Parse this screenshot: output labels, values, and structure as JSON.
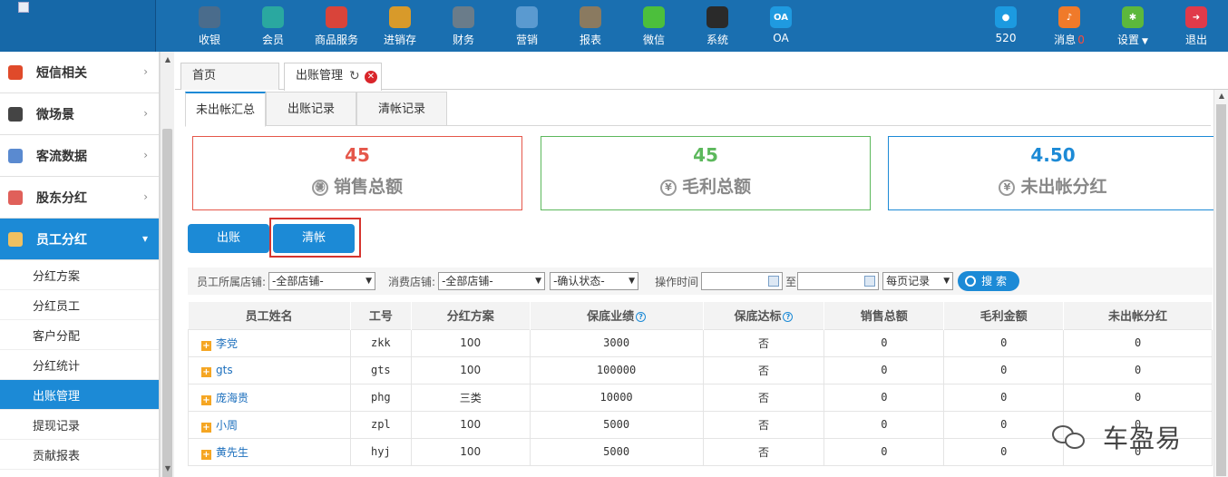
{
  "topnav": {
    "items": [
      {
        "label": "收银",
        "icon": "cash-register-icon",
        "color": "#4a6c8c"
      },
      {
        "label": "会员",
        "icon": "member-icon",
        "color": "#2aa8a0"
      },
      {
        "label": "商品服务",
        "icon": "product-service-icon",
        "color": "#d9443a"
      },
      {
        "label": "进销存",
        "icon": "inventory-icon",
        "color": "#d89a2a"
      },
      {
        "label": "财务",
        "icon": "finance-icon",
        "color": "#6a7c8a"
      },
      {
        "label": "营销",
        "icon": "marketing-icon",
        "color": "#5a9ad0"
      },
      {
        "label": "报表",
        "icon": "report-icon",
        "color": "#8a7a60"
      },
      {
        "label": "微信",
        "icon": "wechat-icon",
        "color": "#4cbf3c"
      },
      {
        "label": "系统",
        "icon": "system-icon",
        "color": "#2a2a2a"
      },
      {
        "label": "OA",
        "icon": "oa-icon",
        "color": "#1f9ae0",
        "text": "OA"
      }
    ],
    "right": {
      "user_label": "520",
      "message_label": "消息",
      "message_count": "0",
      "settings_label": "设置",
      "logout_label": "退出"
    }
  },
  "sidebar": {
    "groups": [
      {
        "label": "短信相关",
        "icon": "phone-icon",
        "color": "#e04a2a"
      },
      {
        "label": "微场景",
        "icon": "mobile-icon",
        "color": "#444"
      },
      {
        "label": "客流数据",
        "icon": "traffic-icon",
        "color": "#5a8ad0"
      },
      {
        "label": "股东分红",
        "icon": "shareholder-icon",
        "color": "#e0605a"
      }
    ],
    "active_group": {
      "label": "员工分红",
      "icon": "staff-icon",
      "color": "#f0c060"
    },
    "subitems": [
      "分红方案",
      "分红员工",
      "客户分配",
      "分红统计",
      "出账管理",
      "提现记录",
      "贡献报表"
    ],
    "active_subitem_index": 4
  },
  "tabs": {
    "home": "首页",
    "active": "出账管理"
  },
  "subtabs": [
    "未出帐汇总",
    "出账记录",
    "清帐记录"
  ],
  "cards": [
    {
      "value": "45",
      "caption": "销售总额",
      "symbol": "㊝"
    },
    {
      "value": "45",
      "caption": "毛利总额",
      "symbol": "¥"
    },
    {
      "value": "4.50",
      "caption": "未出帐分红",
      "symbol": "¥"
    }
  ],
  "buttons": {
    "checkout": "出账",
    "clear": "清帐"
  },
  "filters": {
    "store_label": "员工所属店铺:",
    "store_value": "-全部店铺-",
    "consume_label": "消费店铺:",
    "consume_value": "-全部店铺-",
    "status_value": "-确认状态-",
    "time_label": "操作时间",
    "to_label": "至",
    "per_page_value": "每页记录",
    "search_label": "搜 索"
  },
  "table": {
    "headers": [
      "员工姓名",
      "工号",
      "分红方案",
      "保底业绩",
      "保底达标",
      "销售总额",
      "毛利金额",
      "未出帐分红"
    ],
    "rows": [
      [
        "李党",
        "zkk",
        "100",
        "3000",
        "否",
        "0",
        "0",
        "0"
      ],
      [
        "gts",
        "gts",
        "100",
        "100000",
        "否",
        "0",
        "0",
        "0"
      ],
      [
        "庞海贵",
        "phg",
        "三类",
        "10000",
        "否",
        "0",
        "0",
        "0"
      ],
      [
        "小周",
        "zpl",
        "100",
        "5000",
        "否",
        "0",
        "0",
        "0"
      ],
      [
        "黄先生",
        "hyj",
        "100",
        "5000",
        "否",
        "0",
        "0",
        "0"
      ]
    ]
  },
  "watermark": "车盈易"
}
